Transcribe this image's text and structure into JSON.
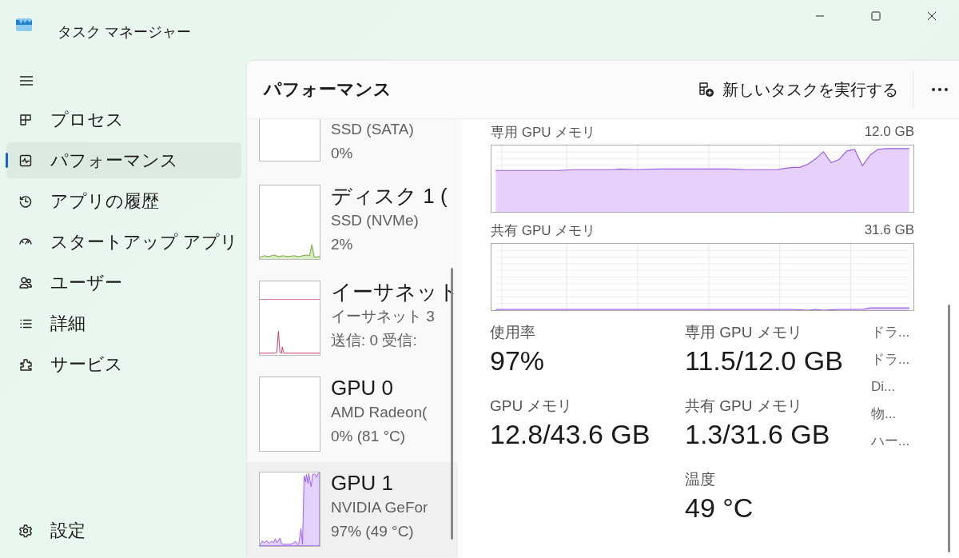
{
  "window": {
    "title": "タスク マネージャー"
  },
  "sidebar": {
    "items": [
      {
        "label": "プロセス",
        "kind": "processes",
        "selected": false
      },
      {
        "label": "パフォーマンス",
        "kind": "performance",
        "selected": true
      },
      {
        "label": "アプリの履歴",
        "kind": "history",
        "selected": false
      },
      {
        "label": "スタートアップ アプリ",
        "kind": "startup",
        "selected": false
      },
      {
        "label": "ユーザー",
        "kind": "users",
        "selected": false
      },
      {
        "label": "詳細",
        "kind": "details",
        "selected": false
      },
      {
        "label": "サービス",
        "kind": "services",
        "selected": false
      }
    ],
    "settings": "設定"
  },
  "page": {
    "title": "パフォーマンス",
    "run_task": "新しいタスクを実行する"
  },
  "devices": [
    {
      "subtitle": "SSD (SATA)",
      "value": "0%",
      "kind": "cut",
      "selected": false
    },
    {
      "title": "ディスク 1 (",
      "subtitle": "SSD (NVMe)",
      "value": "2%",
      "kind": "disk",
      "color": "#6fa03c",
      "selected": false
    },
    {
      "title": "イーサネット",
      "subtitle": "イーサネット 3",
      "value": "送信: 0 受信:",
      "kind": "network",
      "color": "#c4366e",
      "selected": false
    },
    {
      "title": "GPU 0",
      "subtitle": "AMD Radeon(",
      "value": "0% (81 °C)",
      "kind": "empty",
      "selected": false
    },
    {
      "title": "GPU 1",
      "subtitle": "NVIDIA GeFor",
      "value": "97% (49 °C)",
      "kind": "gpu",
      "color": "#9c5ce6",
      "selected": true
    }
  ],
  "charts": [
    {
      "label": "専用 GPU メモリ",
      "max": "12.0 GB",
      "kind": "dedicated"
    },
    {
      "label": "共有 GPU メモリ",
      "max": "31.6 GB",
      "kind": "shared"
    }
  ],
  "stat_columns": [
    {
      "stats": [
        {
          "label": "使用率",
          "value": "97%"
        },
        {
          "label": "GPU メモリ",
          "value": "12.8/43.6 GB"
        }
      ]
    },
    {
      "stats": [
        {
          "label": "専用 GPU メモリ",
          "value": "11.5/12.0 GB"
        },
        {
          "label": "共有 GPU メモリ",
          "value": "1.3/31.6 GB"
        },
        {
          "label": "温度",
          "value": "49 °C"
        }
      ]
    }
  ],
  "properties": [
    "ドラ...",
    "ドラ...",
    "Di...",
    "物...",
    "ハー..."
  ]
}
